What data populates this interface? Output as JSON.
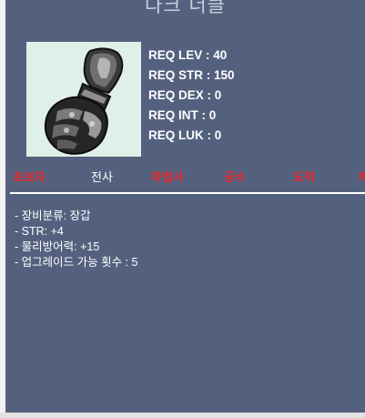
{
  "item": {
    "name": "다크 너클"
  },
  "requirements": [
    {
      "label": "REQ LEV : 40"
    },
    {
      "label": "REQ STR : 150"
    },
    {
      "label": "REQ DEX : 0"
    },
    {
      "label": "REQ INT : 0"
    },
    {
      "label": "REQ LUK : 0"
    }
  ],
  "jobs": [
    {
      "label": "초보자",
      "allowed": false,
      "color": "#e8262a"
    },
    {
      "label": "전사",
      "allowed": true,
      "color": "#ffffff"
    },
    {
      "label": "마법사",
      "allowed": false,
      "color": "#e8262a"
    },
    {
      "label": "궁수",
      "allowed": false,
      "color": "#e8262a"
    },
    {
      "label": "도적",
      "allowed": false,
      "color": "#e8262a"
    },
    {
      "label": "해",
      "allowed": false,
      "color": "#e8262a"
    }
  ],
  "stats": [
    {
      "label": "- 장비분류: 장갑"
    },
    {
      "label": "- STR: +4"
    },
    {
      "label": "- 물리방어력: +15"
    },
    {
      "label": "- 업그레이드 가능 횟수 : 5"
    }
  ],
  "icon": {
    "name": "dark-knuckle-glove-icon",
    "background": "#dff0e8"
  },
  "colors": {
    "panel_background": "#54617e",
    "restricted_job": "#e8262a",
    "allowed_job": "#ffffff"
  }
}
